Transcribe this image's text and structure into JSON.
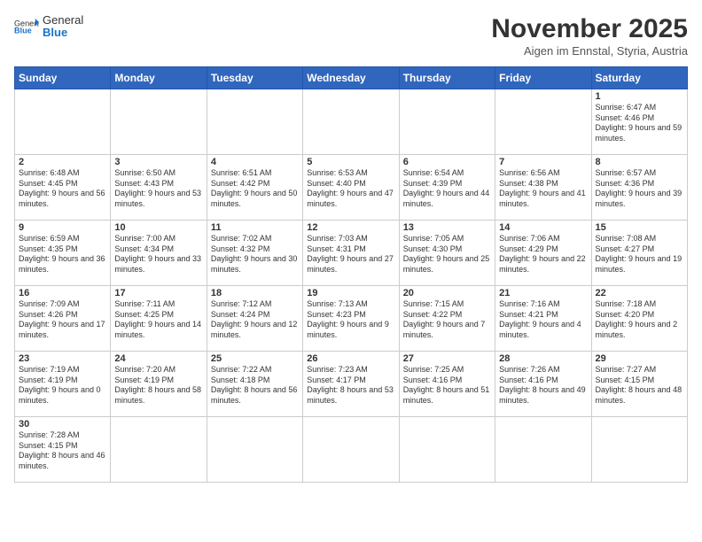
{
  "logo": {
    "text_general": "General",
    "text_blue": "Blue"
  },
  "header": {
    "month": "November 2025",
    "location": "Aigen im Ennstal, Styria, Austria"
  },
  "days_of_week": [
    "Sunday",
    "Monday",
    "Tuesday",
    "Wednesday",
    "Thursday",
    "Friday",
    "Saturday"
  ],
  "weeks": [
    [
      {
        "day": "",
        "info": ""
      },
      {
        "day": "",
        "info": ""
      },
      {
        "day": "",
        "info": ""
      },
      {
        "day": "",
        "info": ""
      },
      {
        "day": "",
        "info": ""
      },
      {
        "day": "",
        "info": ""
      },
      {
        "day": "1",
        "info": "Sunrise: 6:47 AM\nSunset: 4:46 PM\nDaylight: 9 hours and 59 minutes."
      }
    ],
    [
      {
        "day": "2",
        "info": "Sunrise: 6:48 AM\nSunset: 4:45 PM\nDaylight: 9 hours and 56 minutes."
      },
      {
        "day": "3",
        "info": "Sunrise: 6:50 AM\nSunset: 4:43 PM\nDaylight: 9 hours and 53 minutes."
      },
      {
        "day": "4",
        "info": "Sunrise: 6:51 AM\nSunset: 4:42 PM\nDaylight: 9 hours and 50 minutes."
      },
      {
        "day": "5",
        "info": "Sunrise: 6:53 AM\nSunset: 4:40 PM\nDaylight: 9 hours and 47 minutes."
      },
      {
        "day": "6",
        "info": "Sunrise: 6:54 AM\nSunset: 4:39 PM\nDaylight: 9 hours and 44 minutes."
      },
      {
        "day": "7",
        "info": "Sunrise: 6:56 AM\nSunset: 4:38 PM\nDaylight: 9 hours and 41 minutes."
      },
      {
        "day": "8",
        "info": "Sunrise: 6:57 AM\nSunset: 4:36 PM\nDaylight: 9 hours and 39 minutes."
      }
    ],
    [
      {
        "day": "9",
        "info": "Sunrise: 6:59 AM\nSunset: 4:35 PM\nDaylight: 9 hours and 36 minutes."
      },
      {
        "day": "10",
        "info": "Sunrise: 7:00 AM\nSunset: 4:34 PM\nDaylight: 9 hours and 33 minutes."
      },
      {
        "day": "11",
        "info": "Sunrise: 7:02 AM\nSunset: 4:32 PM\nDaylight: 9 hours and 30 minutes."
      },
      {
        "day": "12",
        "info": "Sunrise: 7:03 AM\nSunset: 4:31 PM\nDaylight: 9 hours and 27 minutes."
      },
      {
        "day": "13",
        "info": "Sunrise: 7:05 AM\nSunset: 4:30 PM\nDaylight: 9 hours and 25 minutes."
      },
      {
        "day": "14",
        "info": "Sunrise: 7:06 AM\nSunset: 4:29 PM\nDaylight: 9 hours and 22 minutes."
      },
      {
        "day": "15",
        "info": "Sunrise: 7:08 AM\nSunset: 4:27 PM\nDaylight: 9 hours and 19 minutes."
      }
    ],
    [
      {
        "day": "16",
        "info": "Sunrise: 7:09 AM\nSunset: 4:26 PM\nDaylight: 9 hours and 17 minutes."
      },
      {
        "day": "17",
        "info": "Sunrise: 7:11 AM\nSunset: 4:25 PM\nDaylight: 9 hours and 14 minutes."
      },
      {
        "day": "18",
        "info": "Sunrise: 7:12 AM\nSunset: 4:24 PM\nDaylight: 9 hours and 12 minutes."
      },
      {
        "day": "19",
        "info": "Sunrise: 7:13 AM\nSunset: 4:23 PM\nDaylight: 9 hours and 9 minutes."
      },
      {
        "day": "20",
        "info": "Sunrise: 7:15 AM\nSunset: 4:22 PM\nDaylight: 9 hours and 7 minutes."
      },
      {
        "day": "21",
        "info": "Sunrise: 7:16 AM\nSunset: 4:21 PM\nDaylight: 9 hours and 4 minutes."
      },
      {
        "day": "22",
        "info": "Sunrise: 7:18 AM\nSunset: 4:20 PM\nDaylight: 9 hours and 2 minutes."
      }
    ],
    [
      {
        "day": "23",
        "info": "Sunrise: 7:19 AM\nSunset: 4:19 PM\nDaylight: 9 hours and 0 minutes."
      },
      {
        "day": "24",
        "info": "Sunrise: 7:20 AM\nSunset: 4:19 PM\nDaylight: 8 hours and 58 minutes."
      },
      {
        "day": "25",
        "info": "Sunrise: 7:22 AM\nSunset: 4:18 PM\nDaylight: 8 hours and 56 minutes."
      },
      {
        "day": "26",
        "info": "Sunrise: 7:23 AM\nSunset: 4:17 PM\nDaylight: 8 hours and 53 minutes."
      },
      {
        "day": "27",
        "info": "Sunrise: 7:25 AM\nSunset: 4:16 PM\nDaylight: 8 hours and 51 minutes."
      },
      {
        "day": "28",
        "info": "Sunrise: 7:26 AM\nSunset: 4:16 PM\nDaylight: 8 hours and 49 minutes."
      },
      {
        "day": "29",
        "info": "Sunrise: 7:27 AM\nSunset: 4:15 PM\nDaylight: 8 hours and 48 minutes."
      }
    ],
    [
      {
        "day": "30",
        "info": "Sunrise: 7:28 AM\nSunset: 4:15 PM\nDaylight: 8 hours and 46 minutes."
      },
      {
        "day": "",
        "info": ""
      },
      {
        "day": "",
        "info": ""
      },
      {
        "day": "",
        "info": ""
      },
      {
        "day": "",
        "info": ""
      },
      {
        "day": "",
        "info": ""
      },
      {
        "day": "",
        "info": ""
      }
    ]
  ]
}
